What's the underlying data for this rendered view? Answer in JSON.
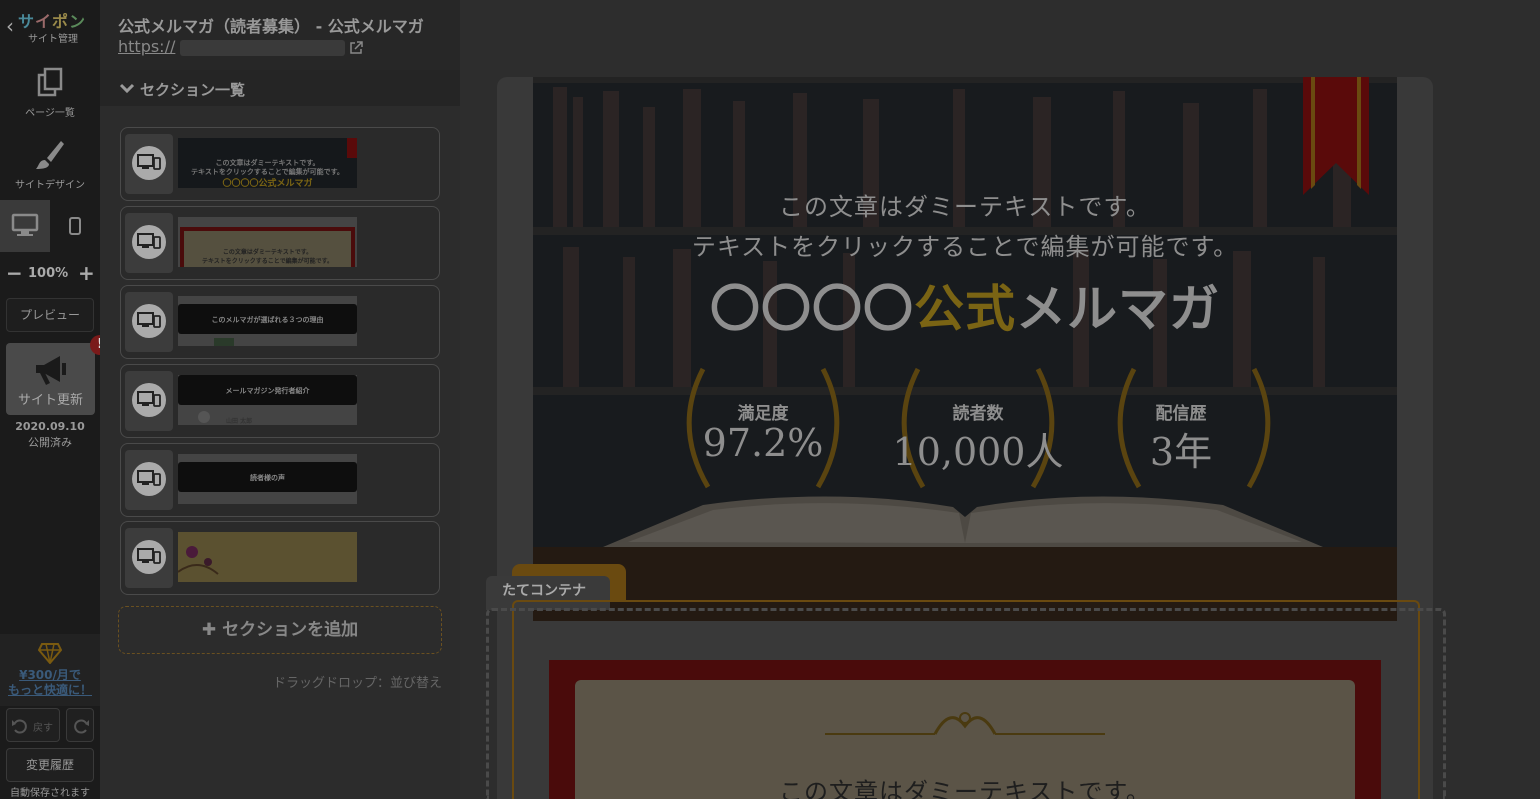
{
  "app": {
    "logo": [
      "サ",
      "イ",
      "ポ",
      "ン"
    ],
    "logo_sub": "サイト管理",
    "nav": {
      "pages": "ページ一覧",
      "design": "サイトデザイン"
    },
    "zoom": "100%",
    "preview": "プレビュー",
    "update": "サイト更新",
    "update_badge": "!",
    "update_date": "2020.09.10",
    "update_status": "公開済み",
    "promo": [
      "¥300/月で",
      "もっと快適に！"
    ],
    "undo": "戻す",
    "history": "変更履歴",
    "autosave": "自動保存されます"
  },
  "panel": {
    "site_title": "公式メルマガ（読者募集） - 公式メルマガ",
    "site_url_prefix": "https://",
    "section_list_title": "セクション一覧",
    "sections": [
      {
        "thumb_lines": [
          "この文章はダミーテキストです。",
          "テキストをクリックすることで編集が可能です。",
          "〇〇〇〇公式メルマガ"
        ]
      },
      {
        "thumb_lines": [
          "この文章はダミーテキストです。",
          "テキストをクリックすることで編集が可能です。"
        ]
      },
      {
        "thumb_lines": [
          "このメルマガが選ばれる３つの理由"
        ]
      },
      {
        "thumb_lines": [
          "メールマガジン発行者紹介",
          "山田 太郎"
        ]
      },
      {
        "thumb_lines": [
          "読者様の声"
        ]
      },
      {
        "thumb_lines": []
      }
    ],
    "add_section": "セクションを追加",
    "dnd_hint": "ドラッグドロップ：並び替え"
  },
  "canvas": {
    "hero": {
      "line1": "この文章はダミーテキストです。",
      "line2": "テキストをクリックすることで編集が可能です。",
      "title_prefix": "〇〇〇〇",
      "title_gold": "公式",
      "title_suffix": "メルマガ",
      "stats": [
        {
          "label": "満足度",
          "value": "97.2%"
        },
        {
          "label": "読者数",
          "value": "10,000人"
        },
        {
          "label": "配信歴",
          "value": "3年"
        }
      ]
    },
    "container_label": "たてコンテナ",
    "section2_line1": "この文章はダミーテキストです。"
  },
  "colors": {
    "accent_gold": "#7a6414",
    "ribbon_red": "#5a0a0a",
    "frame_red": "#4a0b0b"
  }
}
